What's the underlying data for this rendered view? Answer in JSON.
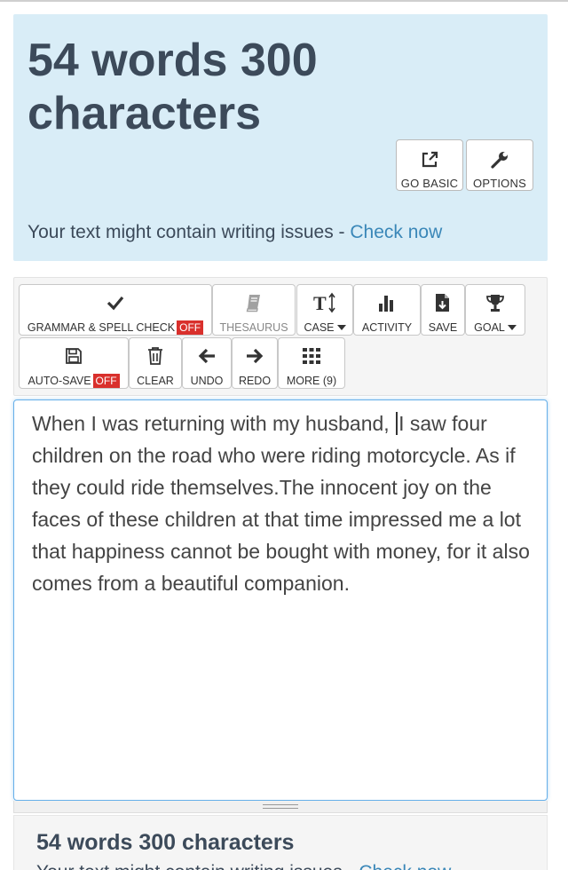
{
  "header": {
    "title": "54 words 300 characters",
    "buttons": {
      "go_basic": "GO BASIC",
      "options": "OPTIONS"
    },
    "issues_text": "Your text might contain writing issues - ",
    "issues_link": "Check now"
  },
  "toolbar": {
    "grammar": {
      "label": "GRAMMAR & SPELL CHECK",
      "state": "OFF"
    },
    "thesaurus": "THESAURUS",
    "case": "CASE",
    "activity": "ACTIVITY",
    "save": "SAVE",
    "goal": "GOAL",
    "auto_save": {
      "label": "AUTO-SAVE",
      "state": "OFF"
    },
    "clear": "CLEAR",
    "undo": "UNDO",
    "redo": "REDO",
    "more": "MORE (9)"
  },
  "editor": {
    "text_before_caret": "When I was returning with my husband, ",
    "text_after_caret": "I saw four children on the road who were riding motorcycle. As if they could ride themselves.The innocent joy on the faces of these children at that time impressed me a lot that happiness cannot be bought with money, for it also comes from a beautiful companion."
  },
  "summary": {
    "title": "54 words 300 characters",
    "issues_text": "Your text might contain writing issues - ",
    "issues_link": "Check now"
  },
  "colors": {
    "header_bg": "#d9edf7",
    "link": "#3a87b8",
    "off_badge": "#d9302c",
    "editor_focus": "#66afe9"
  }
}
